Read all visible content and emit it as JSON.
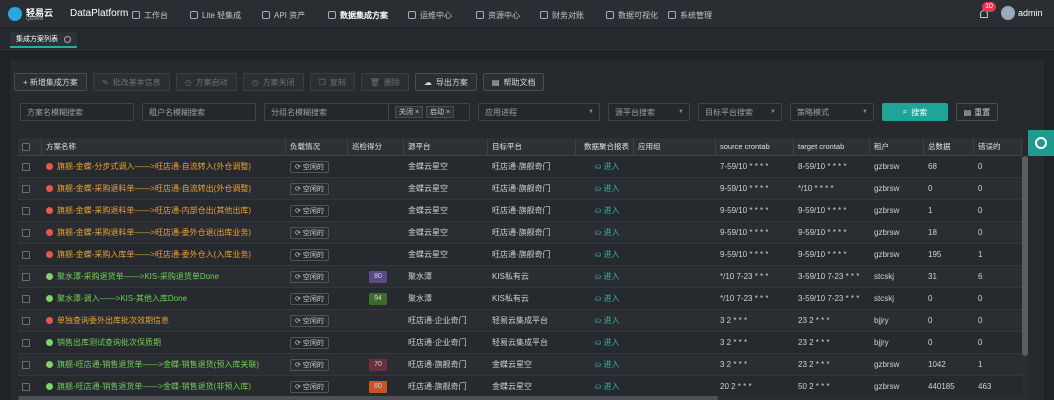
{
  "nav": {
    "logo_text": "轻易云",
    "logo_sub": "QEBest",
    "product": "DataPlatform",
    "items": [
      {
        "label": "工作台",
        "icon": "monitor-icon",
        "active": false
      },
      {
        "label": "Lite 轻集成",
        "icon": "lite-icon",
        "active": false
      },
      {
        "label": "API 资产",
        "icon": "compass-icon",
        "active": false
      },
      {
        "label": "数据集成方案",
        "icon": "tools-icon",
        "active": true
      },
      {
        "label": "运维中心",
        "icon": "rocket-icon",
        "active": false
      },
      {
        "label": "资源中心",
        "icon": "database-icon",
        "active": false
      },
      {
        "label": "财务对账",
        "icon": "finance-icon",
        "active": false
      },
      {
        "label": "数据可视化",
        "icon": "chart-icon",
        "active": false
      },
      {
        "label": "系统管理",
        "icon": "settings-icon",
        "active": false
      }
    ],
    "notifications": "10",
    "user": "admin"
  },
  "tabs": [
    {
      "label": "集成方案列表"
    }
  ],
  "toolbar": {
    "add": "+ 新增集成方案",
    "batch_base": "批改基本信息",
    "start": "方案启动",
    "close": "方案关闭",
    "copy": "复制",
    "delete": "删除",
    "export": "导出方案",
    "help": "帮助文档"
  },
  "filters": {
    "scheme_name": "方案名模糊搜索",
    "tenant_name": "租户名模糊搜索",
    "group_name": "分组名模糊搜索",
    "status_tags": [
      "关闭",
      "启动"
    ],
    "app_process": "应用进程",
    "source_platform": "源平台搜索",
    "target_platform": "目标平台搜索",
    "strategy": "策略模式",
    "search_btn": "搜索",
    "reset_btn": "重置"
  },
  "table": {
    "columns": [
      "方案名称",
      "负载情况",
      "巡检得分",
      "源平台",
      "目标平台",
      "数据聚合报表",
      "应用组",
      "source crontab",
      "target crontab",
      "租户",
      "总数据",
      "错误的"
    ],
    "load_label": "空闲的",
    "report_label": "进入",
    "rows": [
      {
        "name": "旗舰-金蝶-分步式调入——>旺店通-自流转入(外仓调整)",
        "status": "off",
        "score": "",
        "score_color": "",
        "source": "金蝶云星空",
        "target": "旺店通·旗舰奇门",
        "src_cron": "7-59/10 * * * *",
        "tgt_cron": "8-59/10 * * * *",
        "tenant": "gzbrsw",
        "total": "68",
        "err": "0"
      },
      {
        "name": "旗舰-金蝶-采购退料单——>旺店通-自流转出(外仓调整)",
        "status": "off",
        "score": "",
        "score_color": "",
        "source": "金蝶云星空",
        "target": "旺店通·旗舰奇门",
        "src_cron": "9-59/10 * * * *",
        "tgt_cron": "*/10 * * * *",
        "tenant": "gzbrsw",
        "total": "0",
        "err": "0"
      },
      {
        "name": "旗舰-金蝶-采购退料单——>旺店通-内部仓出(其他出库)",
        "status": "off",
        "score": "",
        "score_color": "",
        "source": "金蝶云星空",
        "target": "旺店通·旗舰奇门",
        "src_cron": "9-59/10 * * * *",
        "tgt_cron": "9-59/10 * * * *",
        "tenant": "gzbrsw",
        "total": "1",
        "err": "0"
      },
      {
        "name": "旗舰-金蝶-采购退料单——>旺店通-委外仓退(出库业务)",
        "status": "off",
        "score": "",
        "score_color": "",
        "source": "金蝶云星空",
        "target": "旺店通·旗舰奇门",
        "src_cron": "9-59/10 * * * *",
        "tgt_cron": "9-59/10 * * * *",
        "tenant": "gzbrsw",
        "total": "18",
        "err": "0"
      },
      {
        "name": "旗舰-金蝶-采购入库单——>旺店通-委外仓入(入库业务)",
        "status": "off",
        "score": "",
        "score_color": "",
        "source": "金蝶云星空",
        "target": "旺店通·旗舰奇门",
        "src_cron": "9-59/10 * * * *",
        "tgt_cron": "9-59/10 * * * *",
        "tenant": "gzbrsw",
        "total": "195",
        "err": "1"
      },
      {
        "name": "聚水潭-采购退货单——>KIS-采购退货单Done",
        "status": "on",
        "score": "80",
        "score_color": "#5b4a8a",
        "source": "聚水潭",
        "target": "KIS私有云",
        "src_cron": "*/10 7-23 * * *",
        "tgt_cron": "3-59/10 7-23 * * *",
        "tenant": "stcskj",
        "total": "31",
        "err": "6"
      },
      {
        "name": "聚水潭-调入——>KIS-其他入库Done",
        "status": "on",
        "score": "94",
        "score_color": "#3f6b2a",
        "source": "聚水潭",
        "target": "KIS私有云",
        "src_cron": "*/10 7-23 * * *",
        "tgt_cron": "3-59/10 7-23 * * *",
        "tenant": "stcskj",
        "total": "0",
        "err": "0"
      },
      {
        "name": "单独查询委外出库批次效期信息",
        "status": "off",
        "score": "",
        "score_color": "",
        "source": "旺店通·企业奇门",
        "target": "轻易云集成平台",
        "src_cron": "3 2 * * *",
        "tgt_cron": "23 2 * * *",
        "tenant": "bjjry",
        "total": "0",
        "err": "0"
      },
      {
        "name": "销售出库测试查询批次保质期",
        "status": "on",
        "score": "",
        "score_color": "",
        "source": "旺店通·企业奇门",
        "target": "轻易云集成平台",
        "src_cron": "3 2 * * *",
        "tgt_cron": "23 2 * * *",
        "tenant": "bjjry",
        "total": "0",
        "err": "0"
      },
      {
        "name": "旗舰-旺店通-销售退货单——>金蝶-销售退货(预入库关联)",
        "status": "on",
        "score": "70",
        "score_color": "#6a3040",
        "source": "旺店通·旗舰奇门",
        "target": "金蝶云星空",
        "src_cron": "3 2 * * *",
        "tgt_cron": "23 2 * * *",
        "tenant": "gzbrsw",
        "total": "1042",
        "err": "1"
      },
      {
        "name": "旗舰-旺店通-销售退货单——>金蝶-销售退货(非预入库)",
        "status": "on",
        "score": "60",
        "score_color": "#c8552a",
        "source": "旺店通·旗舰奇门",
        "target": "金蝶云星空",
        "src_cron": "20 2 * * *",
        "tgt_cron": "50 2 * * *",
        "tenant": "gzbrsw",
        "total": "440185",
        "err": "463"
      },
      {
        "name": "",
        "status": "on",
        "score": "",
        "score_color": "#2c6a3a",
        "source": "",
        "target": "",
        "src_cron": "",
        "tgt_cron": "",
        "tenant": "",
        "total": "",
        "err": ""
      }
    ]
  }
}
